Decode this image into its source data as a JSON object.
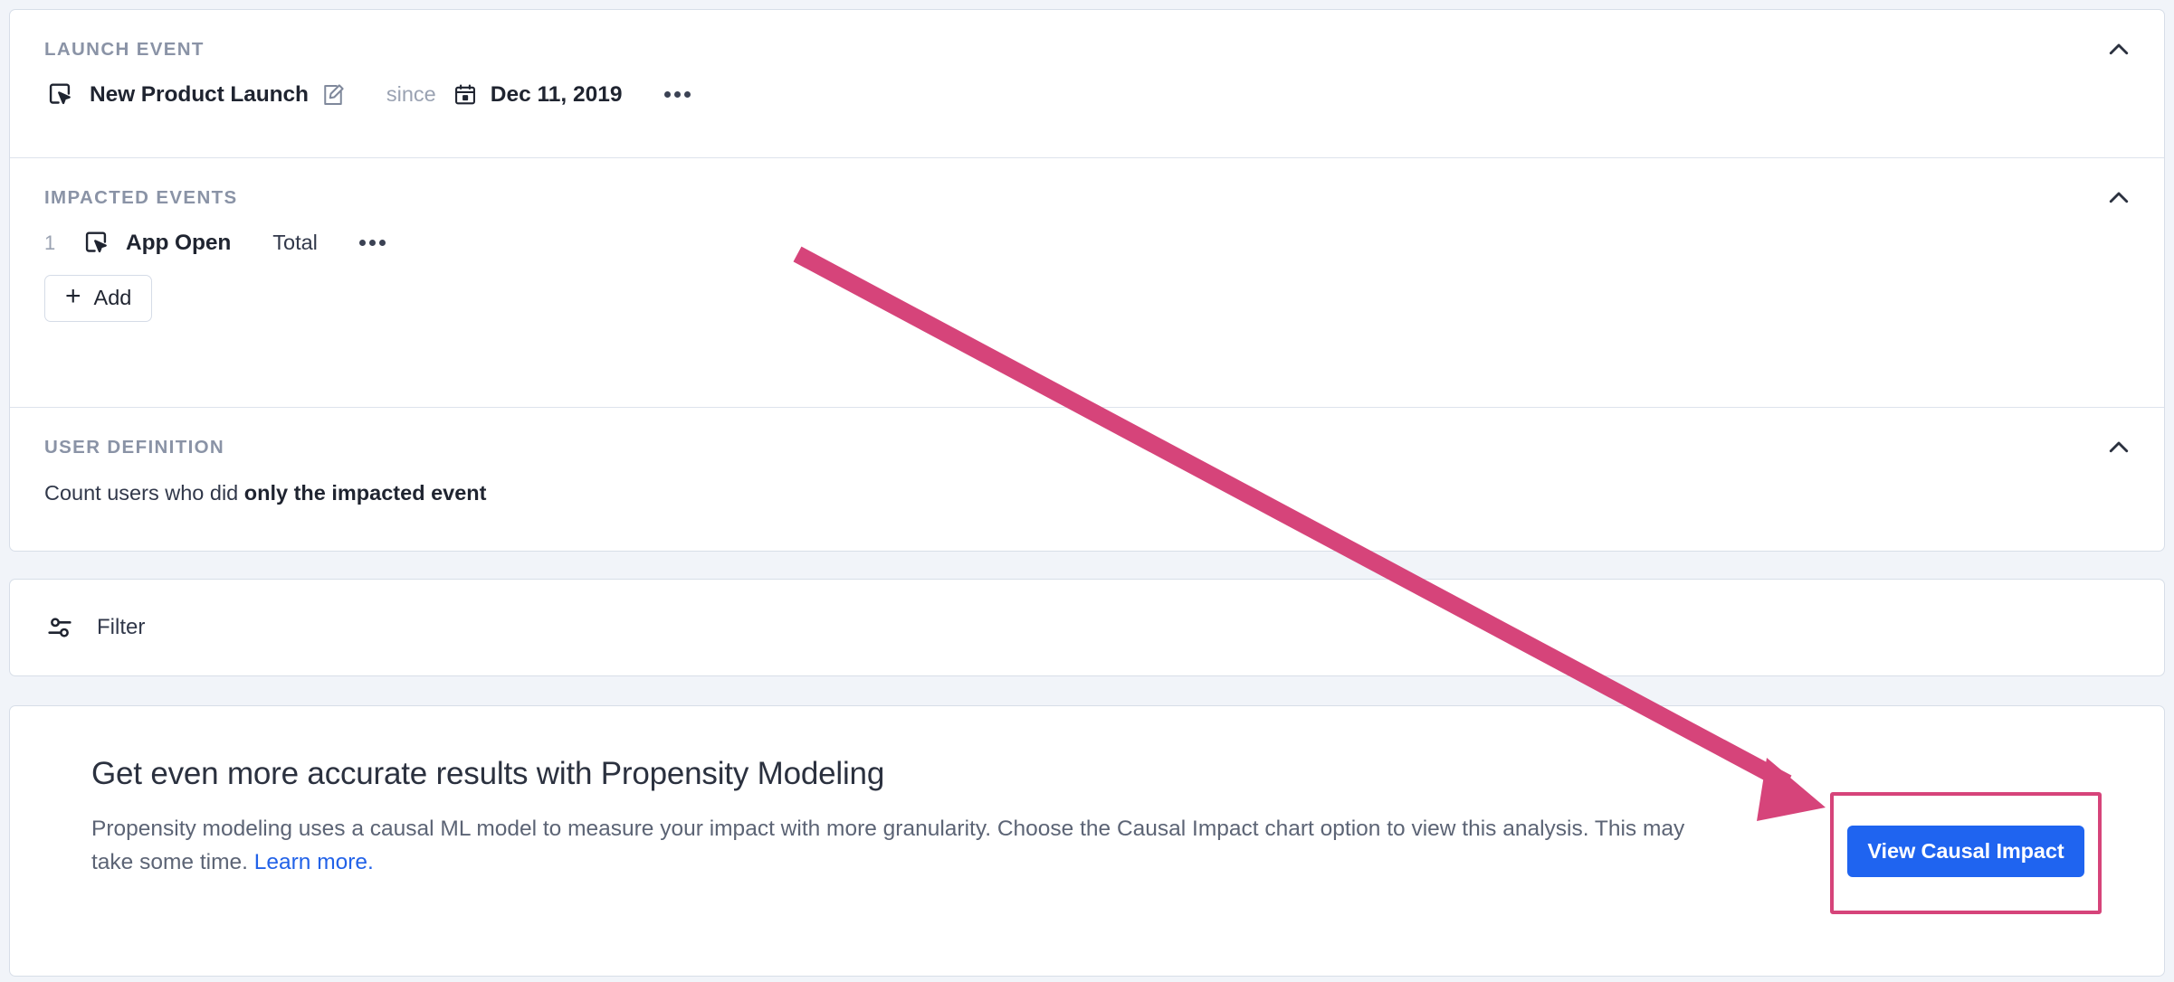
{
  "sections": {
    "launch_event": {
      "label": "LAUNCH EVENT",
      "collapse_icon": "chevron-up-icon",
      "event": {
        "icon": "cursor-click-icon",
        "name": "New Product Launch",
        "edit_icon": "pencil-edit-icon",
        "since_label": "since",
        "date_icon": "calendar-icon",
        "date": "Dec 11, 2019",
        "more_icon": "ellipsis-icon"
      }
    },
    "impacted_events": {
      "label": "IMPACTED EVENTS",
      "collapse_icon": "chevron-up-icon",
      "rows": [
        {
          "index": "1",
          "icon": "cursor-click-icon",
          "name": "App Open",
          "aggregation": "Total",
          "more_icon": "ellipsis-icon"
        }
      ],
      "add_button": {
        "icon": "plus-icon",
        "label": "Add"
      }
    },
    "user_definition": {
      "label": "USER DEFINITION",
      "collapse_icon": "chevron-up-icon",
      "text_prefix": "Count users who did ",
      "text_emphasis": "only the impacted event"
    },
    "filter": {
      "icon": "filter-sliders-icon",
      "label": "Filter"
    },
    "promo": {
      "title": "Get even more accurate results with Propensity Modeling",
      "body_part1": "Propensity modeling uses a causal ML model to measure your impact with more granularity. Choose the Causal Impact chart option to view this analysis. This may take some time. ",
      "link_text": "Learn more.",
      "cta_label": "View Causal Impact"
    }
  },
  "annotation": {
    "type": "arrow",
    "color": "#d6447a",
    "highlight_box_color": "#d6447a",
    "points_to": "View Causal Impact"
  },
  "colors": {
    "page_background": "#f1f4f9",
    "card_background": "#ffffff",
    "card_border": "#d7dee8",
    "label_text": "#8a93a6",
    "primary_text": "#1f2430",
    "secondary_text": "#5c6475",
    "link_blue": "#2262e8",
    "cta_blue": "#1f64f0",
    "annotation_pink": "#d6447a"
  }
}
